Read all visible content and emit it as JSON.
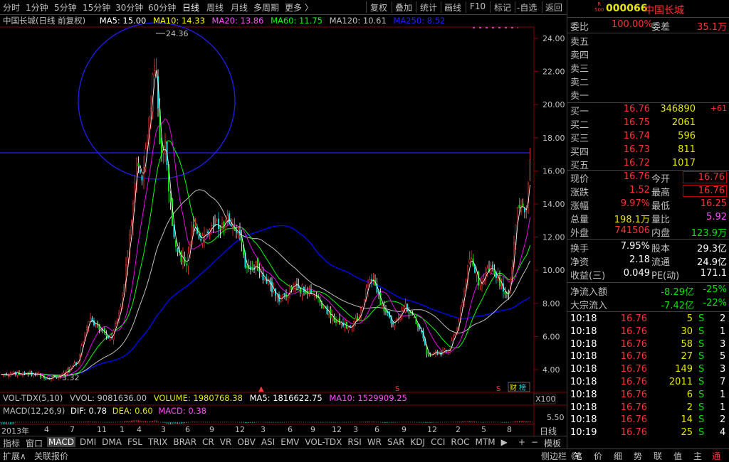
{
  "toolbar": {
    "left": [
      "分时",
      "1分钟",
      "5分钟",
      "15分钟",
      "30分钟",
      "60分钟",
      "日线",
      "周线",
      "月线",
      "多周期",
      "更多 〉"
    ],
    "active": "日线",
    "right": [
      "复权",
      "叠加",
      "统计",
      "画线",
      "F10",
      "标记",
      "-自选",
      "返回"
    ]
  },
  "legend": {
    "title": "中国长城(日线 前复权)",
    "ma5": "MA5: 15.00",
    "ma10": "MA10: 14.33",
    "ma20": "MA20: 13.86",
    "ma60": "MA60: 11.75",
    "ma120": "MA120: 10.61",
    "ma250": "MA250: 8.52"
  },
  "annotations": {
    "high": "24.36",
    "low": "3.32"
  },
  "y_labels": [
    "24.00",
    "22.00",
    "20.00",
    "18.00",
    "16.00",
    "14.00",
    "12.00",
    "10.00",
    "8.00",
    "6.00",
    "4.00"
  ],
  "volume_legend": {
    "name": "VOL-TDX(5,10)",
    "vvol": "VVOL: 9081636.00",
    "volume": "VOLUME: 1980768.38",
    "ma5": "MA5: 1816622.75",
    "ma10": "MA10: 1529909.25",
    "x100": "X100"
  },
  "macd_legend": {
    "name": "MACD(12,26,9)",
    "dif": "DIF: 0.78",
    "dea": "DEA: 0.60",
    "macd": "MACD: 0.38",
    "axis": "5.50"
  },
  "time_axis": [
    "2013年",
    "4",
    "7",
    "11",
    "1",
    "4",
    "3",
    "6",
    "9",
    "12",
    "3",
    "6",
    "9",
    "12",
    "3",
    "6",
    "9",
    "12",
    "2",
    "5",
    "8"
  ],
  "time_axis_right": "日线",
  "finance_badge": "财",
  "finance_badge2": "榜",
  "indicators": [
    "指标",
    "窗口",
    "MACD",
    "DMI",
    "DMA",
    "FSL",
    "TRIX",
    "BRAR",
    "CR",
    "VR",
    "OBV",
    "ASI",
    "EMV",
    "VOL-TDX",
    "RSI",
    "WR",
    "SAR",
    "KDJ",
    "CCI",
    "ROC",
    "MTM",
    "▶"
  ],
  "indicators_active": "MACD",
  "indicators_right": [
    "+",
    "−",
    "模板"
  ],
  "bottom": [
    "扩展∧",
    "关联报价"
  ],
  "bottom_right": [
    "侧边栏《",
    "笔",
    "价",
    "细",
    "势",
    "联",
    "值",
    "主",
    "通"
  ],
  "stock": {
    "rank_top": "R",
    "rank_bottom": "500",
    "code": "000066",
    "name": "中国长城"
  },
  "weibi": {
    "label": "委比",
    "value": "100.00%",
    "label2": "委差",
    "value2": "35.1万"
  },
  "sell": [
    {
      "label": "卖五",
      "price": "",
      "vol": ""
    },
    {
      "label": "卖四",
      "price": "",
      "vol": ""
    },
    {
      "label": "卖三",
      "price": "",
      "vol": ""
    },
    {
      "label": "卖二",
      "price": "",
      "vol": ""
    },
    {
      "label": "卖一",
      "price": "",
      "vol": ""
    }
  ],
  "buy": [
    {
      "label": "买一",
      "price": "16.76",
      "vol": "346890",
      "chg": "+61"
    },
    {
      "label": "买二",
      "price": "16.75",
      "vol": "2061",
      "chg": ""
    },
    {
      "label": "买三",
      "price": "16.74",
      "vol": "596",
      "chg": ""
    },
    {
      "label": "买四",
      "price": "16.73",
      "vol": "811",
      "chg": ""
    },
    {
      "label": "买五",
      "price": "16.72",
      "vol": "1017",
      "chg": ""
    }
  ],
  "quote": [
    {
      "l1": "现价",
      "v1": "16.76",
      "l2": "今开",
      "v2": "16.76",
      "c1": "red",
      "c2": "red",
      "box2": true
    },
    {
      "l1": "涨跌",
      "v1": "1.52",
      "l2": "最高",
      "v2": "16.76",
      "c1": "red",
      "c2": "red",
      "box2": true
    },
    {
      "l1": "涨幅",
      "v1": "9.97%",
      "l2": "最低",
      "v2": "16.25",
      "c1": "red",
      "c2": "red",
      "box2": false
    },
    {
      "l1": "总量",
      "v1": "198.1万",
      "l2": "量比",
      "v2": "5.92",
      "c1": "yellow",
      "c2": "magenta",
      "box2": false
    },
    {
      "l1": "外盘",
      "v1": "741506",
      "l2": "内盘",
      "v2": "123.9万",
      "c1": "red",
      "c2": "green",
      "box2": false
    }
  ],
  "fundamentals": [
    {
      "l1": "换手",
      "v1": "7.95%",
      "l2": "股本",
      "v2": "29.3亿"
    },
    {
      "l1": "净资",
      "v1": "2.18",
      "l2": "流通",
      "v2": "24.9亿"
    },
    {
      "l1": "收益(三)",
      "v1": "0.049",
      "l2": "PE(动)",
      "v2": "171.1"
    }
  ],
  "flows": [
    {
      "label": "净流入额",
      "v1": "-8.29亿",
      "v2": "-25%"
    },
    {
      "label": "大宗流入",
      "v1": "-7.42亿",
      "v2": "-22%"
    }
  ],
  "ticks": [
    {
      "time": "10:18",
      "price": "16.76",
      "vol": "5",
      "side": "S",
      "n": "2"
    },
    {
      "time": "10:18",
      "price": "16.76",
      "vol": "30",
      "side": "S",
      "n": "1"
    },
    {
      "time": "10:18",
      "price": "16.76",
      "vol": "58",
      "side": "S",
      "n": "3"
    },
    {
      "time": "10:18",
      "price": "16.76",
      "vol": "27",
      "side": "S",
      "n": "5"
    },
    {
      "time": "10:18",
      "price": "16.76",
      "vol": "149",
      "side": "S",
      "n": "3"
    },
    {
      "time": "10:18",
      "price": "16.76",
      "vol": "2011",
      "side": "S",
      "n": "7"
    },
    {
      "time": "10:18",
      "price": "16.76",
      "vol": "6",
      "side": "S",
      "n": "1"
    },
    {
      "time": "10:18",
      "price": "16.76",
      "vol": "2",
      "side": "S",
      "n": "1"
    },
    {
      "time": "10:18",
      "price": "16.76",
      "vol": "14",
      "side": "S",
      "n": "2"
    },
    {
      "time": "10:19",
      "price": "16.76",
      "vol": "25",
      "side": "S",
      "n": "4"
    }
  ],
  "colors": {
    "up": "#ff3232",
    "down": "#00e600",
    "ma5": "#ffffff",
    "ma10": "#ffff00",
    "ma20": "#ff00ff",
    "ma60": "#00ff00",
    "ma120": "#c0c0c0",
    "ma250": "#0000ff",
    "circle": "#2020ff"
  }
}
